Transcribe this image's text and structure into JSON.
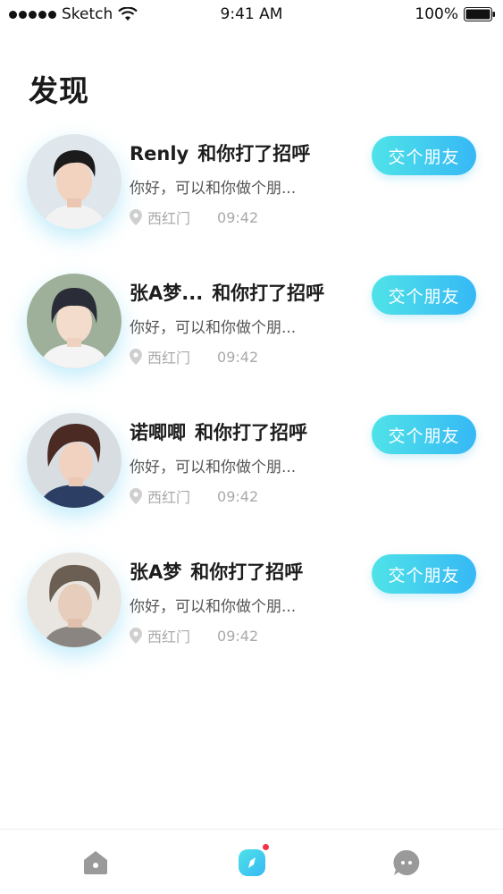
{
  "status_bar": {
    "carrier": "Sketch",
    "time": "9:41 AM",
    "battery": "100%"
  },
  "page": {
    "title": "发现"
  },
  "items": [
    {
      "name": "Renly",
      "action": "和你打了招呼",
      "message": "你好，可以和你做个朋...",
      "location": "西红门",
      "time": "09:42",
      "button_label": "交个朋友"
    },
    {
      "name": "张A梦...",
      "action": "和你打了招呼",
      "message": "你好，可以和你做个朋...",
      "location": "西红门",
      "time": "09:42",
      "button_label": "交个朋友"
    },
    {
      "name": "诺唧唧",
      "action": "和你打了招呼",
      "message": "你好，可以和你做个朋...",
      "location": "西红门",
      "time": "09:42",
      "button_label": "交个朋友"
    },
    {
      "name": "张A梦",
      "action": "和你打了招呼",
      "message": "你好，可以和你做个朋...",
      "location": "西红门",
      "time": "09:42",
      "button_label": "交个朋友"
    }
  ],
  "tab_bar": {
    "tabs": [
      {
        "icon": "home-icon",
        "active": false
      },
      {
        "icon": "discover-icon",
        "active": true,
        "badge": true
      },
      {
        "icon": "chat-icon",
        "active": false
      }
    ]
  },
  "colors": {
    "accent_start": "#4fe3e8",
    "accent_end": "#36b8f5",
    "badge": "#f0334a",
    "inactive_icon": "#9a9a9a"
  }
}
